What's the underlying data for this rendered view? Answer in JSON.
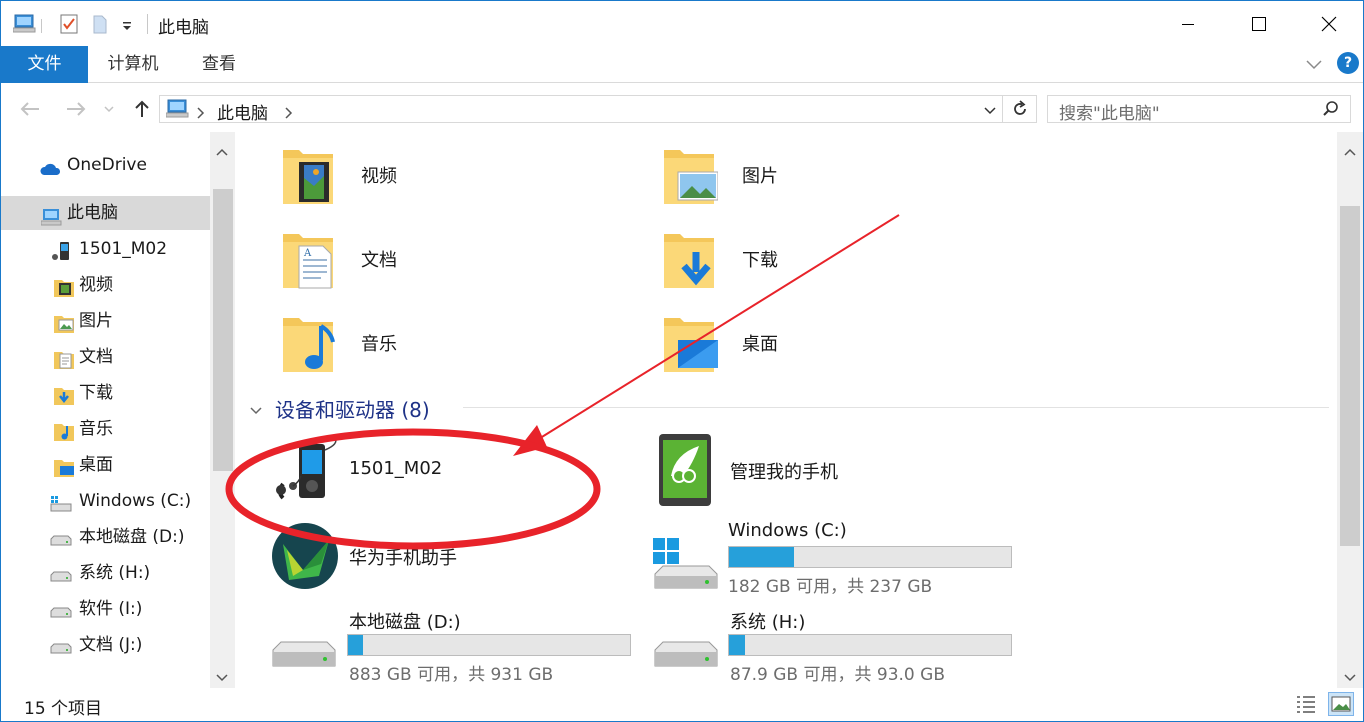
{
  "window": {
    "title": "此电脑"
  },
  "ribbon": {
    "tabs": [
      "文件",
      "计算机",
      "查看"
    ],
    "help": "?"
  },
  "address": {
    "path": "此电脑",
    "search_placeholder": "搜索\"此电脑\""
  },
  "sidebar": {
    "items": [
      {
        "label": "OneDrive",
        "icon": "cloud-icon"
      },
      {
        "label": "此电脑",
        "icon": "computer-icon"
      },
      {
        "label": "1501_M02",
        "icon": "portable-device-icon"
      },
      {
        "label": "视频",
        "icon": "videos-folder-icon"
      },
      {
        "label": "图片",
        "icon": "pictures-folder-icon"
      },
      {
        "label": "文档",
        "icon": "documents-folder-icon"
      },
      {
        "label": "下载",
        "icon": "downloads-folder-icon"
      },
      {
        "label": "音乐",
        "icon": "music-folder-icon"
      },
      {
        "label": "桌面",
        "icon": "desktop-folder-icon"
      },
      {
        "label": "Windows (C:)",
        "icon": "windows-drive-icon"
      },
      {
        "label": "本地磁盘 (D:)",
        "icon": "drive-icon"
      },
      {
        "label": "系统 (H:)",
        "icon": "drive-icon"
      },
      {
        "label": "软件 (I:)",
        "icon": "drive-icon"
      },
      {
        "label": "文档 (J:)",
        "icon": "drive-icon"
      }
    ]
  },
  "folders": [
    {
      "label": "视频",
      "icon": "videos-folder-icon"
    },
    {
      "label": "图片",
      "icon": "pictures-folder-icon"
    },
    {
      "label": "文档",
      "icon": "documents-folder-icon"
    },
    {
      "label": "下载",
      "icon": "downloads-folder-icon"
    },
    {
      "label": "音乐",
      "icon": "music-folder-icon"
    },
    {
      "label": "桌面",
      "icon": "desktop-folder-icon"
    }
  ],
  "devices": {
    "header": "设备和驱动器 (8)",
    "portable": [
      {
        "label": "1501_M02",
        "icon": "media-player-icon"
      },
      {
        "label": "管理我的手机",
        "icon": "phone-manager-icon"
      },
      {
        "label": "华为手机助手",
        "icon": "huawei-assistant-icon"
      }
    ],
    "drives": [
      {
        "name": "Windows (C:)",
        "free": "182 GB 可用，共 237 GB",
        "used_fraction": 0.232
      },
      {
        "name": "本地磁盘 (D:)",
        "free": "883 GB 可用，共 931 GB",
        "used_fraction": 0.052
      },
      {
        "name": "系统 (H:)",
        "free": "87.9 GB 可用，共 93.0 GB",
        "used_fraction": 0.055
      }
    ]
  },
  "status": {
    "count": "15 个项目"
  },
  "colors": {
    "accent": "#1979ca",
    "drive_fill": "#26a0da",
    "annotation": "#e8232a",
    "group_header": "#1e3287"
  }
}
